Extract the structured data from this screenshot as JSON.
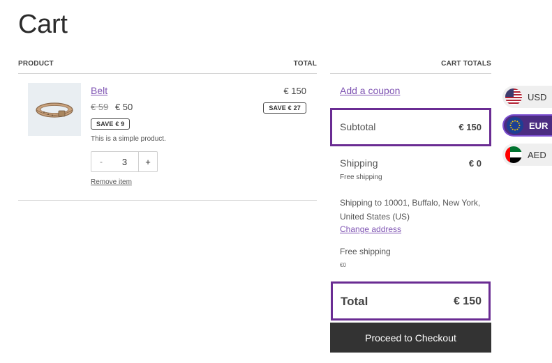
{
  "page": {
    "title": "Cart"
  },
  "table": {
    "col_product": "PRODUCT",
    "col_total": "TOTAL"
  },
  "item": {
    "name": "Belt",
    "old_price": "€ 59",
    "price": "€ 50",
    "item_badge": "SAVE € 9",
    "description": "This is a simple product.",
    "qty_minus": "-",
    "quantity": "3",
    "qty_plus": "+",
    "remove_label": "Remove item",
    "line_total": "€ 150",
    "line_badge": "SAVE € 27"
  },
  "totals": {
    "heading": "CART TOTALS",
    "coupon_label": "Add a coupon",
    "subtotal_label": "Subtotal",
    "subtotal_value": "€ 150",
    "shipping_label": "Shipping",
    "shipping_value": "€ 0",
    "shipping_method": "Free shipping",
    "shipping_to": "Shipping to 10001, Buffalo, New York, United States (US)",
    "change_address": "Change address",
    "option_label": "Free shipping",
    "option_value": "€0",
    "total_label": "Total",
    "total_value": "€ 150",
    "checkout_label": "Proceed to Checkout",
    "highlight_color": "#6a2c93"
  },
  "currencies": [
    {
      "code": "USD",
      "flag": "us-flag-icon",
      "active": false
    },
    {
      "code": "EUR",
      "flag": "eu-flag-icon",
      "active": true
    },
    {
      "code": "AED",
      "flag": "ae-flag-icon",
      "active": false
    }
  ]
}
